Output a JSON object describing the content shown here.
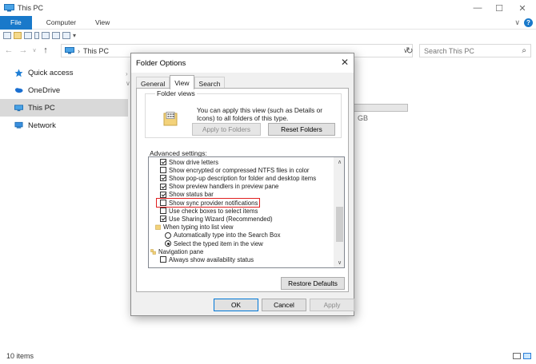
{
  "window": {
    "title": "This PC",
    "minimize": "—",
    "maximize": "☐",
    "close": "✕"
  },
  "ribbon": {
    "tabs": [
      "File",
      "Computer",
      "View"
    ],
    "expand": "∨",
    "help": "?"
  },
  "address": {
    "back": "←",
    "forward": "→",
    "recent": "∨",
    "up": "↑",
    "separator": "›",
    "crumb": "This PC",
    "dropdown": "∨",
    "refresh": "↻",
    "search_placeholder": "Search This PC",
    "search_icon": "⌕"
  },
  "sidebar": {
    "items": [
      {
        "label": "Quick access",
        "icon": "star-icon"
      },
      {
        "label": "OneDrive",
        "icon": "cloud-icon"
      },
      {
        "label": "This PC",
        "icon": "computer-icon"
      },
      {
        "label": "Network",
        "icon": "network-icon"
      }
    ]
  },
  "content": {
    "drive_size_suffix": "GB",
    "collapse_chevrons": "›\n∨"
  },
  "status": {
    "items_count": "10 items"
  },
  "dialog": {
    "title": "Folder Options",
    "close": "✕",
    "tabs": [
      "General",
      "View",
      "Search"
    ],
    "folder_views": {
      "legend": "Folder views",
      "description": "You can apply this view (such as Details or Icons) to all folders of this type.",
      "apply_button": "Apply to Folders",
      "reset_button": "Reset Folders"
    },
    "advanced_label": "Advanced settings:",
    "advanced_items": [
      {
        "type": "checkbox",
        "checked": true,
        "label": "Show drive letters"
      },
      {
        "type": "checkbox",
        "checked": false,
        "label": "Show encrypted or compressed NTFS files in color"
      },
      {
        "type": "checkbox",
        "checked": true,
        "label": "Show pop-up description for folder and desktop items"
      },
      {
        "type": "checkbox",
        "checked": true,
        "label": "Show preview handlers in preview pane"
      },
      {
        "type": "checkbox",
        "checked": true,
        "label": "Show status bar"
      },
      {
        "type": "checkbox",
        "checked": false,
        "label": "Show sync provider notifications"
      },
      {
        "type": "checkbox",
        "checked": false,
        "label": "Use check boxes to select items"
      },
      {
        "type": "checkbox",
        "checked": true,
        "label": "Use Sharing Wizard (Recommended)"
      },
      {
        "type": "folder",
        "label": "When typing into list view"
      },
      {
        "type": "radio",
        "checked": false,
        "label": "Automatically type into the Search Box"
      },
      {
        "type": "radio",
        "checked": true,
        "label": "Select the typed item in the view"
      },
      {
        "type": "nav",
        "label": "Navigation pane"
      },
      {
        "type": "checkbox",
        "checked": false,
        "label": "Always show availability status"
      }
    ],
    "scroll_up": "∧",
    "scroll_down": "∨",
    "restore_button": "Restore Defaults",
    "ok_button": "OK",
    "cancel_button": "Cancel",
    "apply_button": "Apply"
  }
}
